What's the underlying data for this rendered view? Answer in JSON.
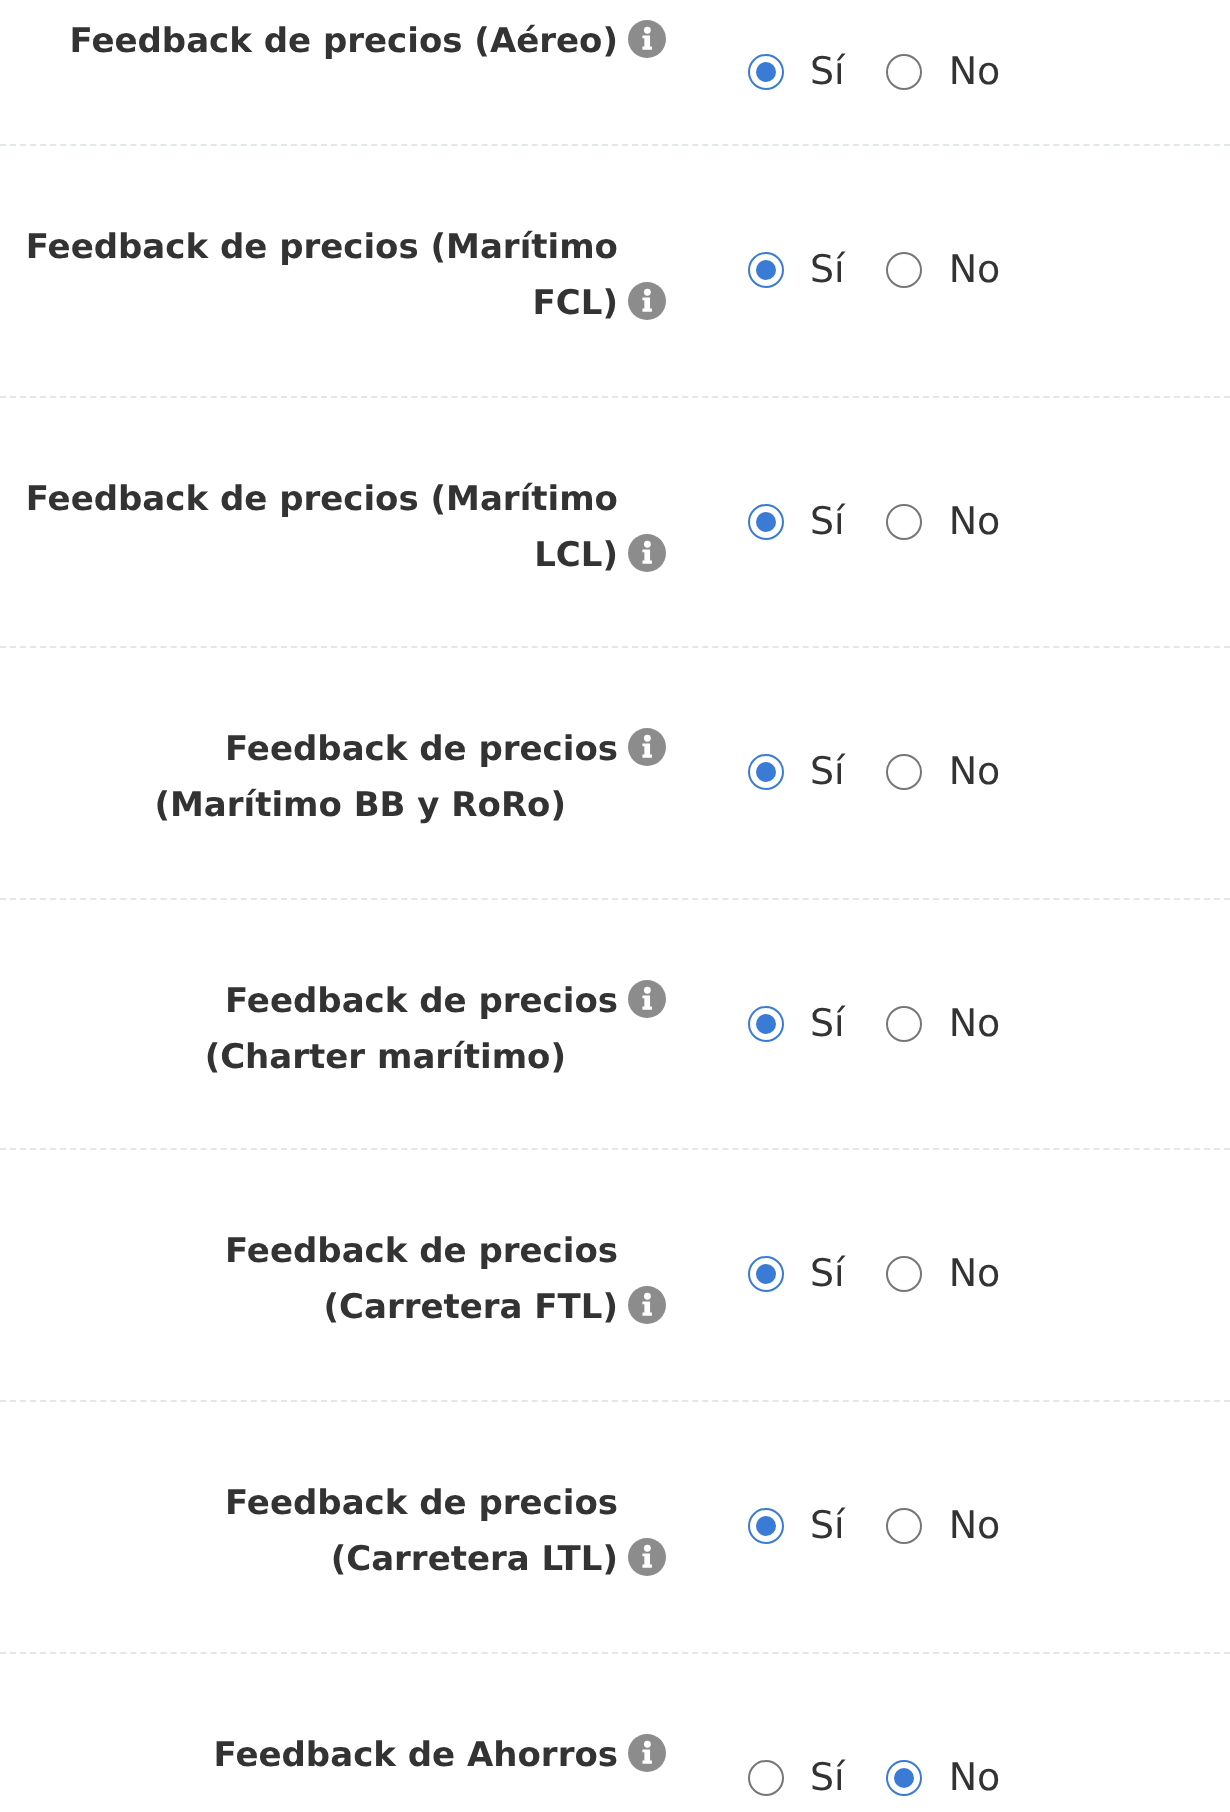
{
  "settings": [
    {
      "label": "Feedback de precios (Aéreo)",
      "options": [
        {
          "label": "Sí",
          "selected": true
        },
        {
          "label": "No",
          "selected": false
        }
      ]
    },
    {
      "label": "Feedback de precios (Marítimo FCL)",
      "options": [
        {
          "label": "Sí",
          "selected": true
        },
        {
          "label": "No",
          "selected": false
        }
      ]
    },
    {
      "label": "Feedback de precios (Marítimo LCL)",
      "options": [
        {
          "label": "Sí",
          "selected": true
        },
        {
          "label": "No",
          "selected": false
        }
      ]
    },
    {
      "label": "Feedback de precios",
      "sublabel": "(Marítimo BB y RoRo)",
      "options": [
        {
          "label": "Sí",
          "selected": true
        },
        {
          "label": "No",
          "selected": false
        }
      ]
    },
    {
      "label": "Feedback de precios",
      "sublabel": "(Charter marítimo)",
      "options": [
        {
          "label": "Sí",
          "selected": true
        },
        {
          "label": "No",
          "selected": false
        }
      ]
    },
    {
      "label": "Feedback de precios (Carretera FTL)",
      "options": [
        {
          "label": "Sí",
          "selected": true
        },
        {
          "label": "No",
          "selected": false
        }
      ]
    },
    {
      "label": "Feedback de precios (Carretera LTL)",
      "options": [
        {
          "label": "Sí",
          "selected": true
        },
        {
          "label": "No",
          "selected": false
        }
      ]
    },
    {
      "label": "Feedback de Ahorros",
      "options": [
        {
          "label": "Sí",
          "selected": false
        },
        {
          "label": "No",
          "selected": true
        }
      ]
    }
  ]
}
